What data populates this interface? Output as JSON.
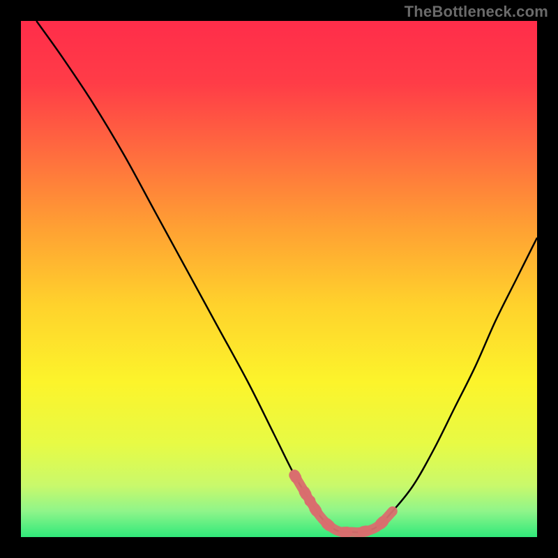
{
  "watermark": "TheBottleneck.com",
  "chart_data": {
    "type": "line",
    "title": "",
    "xlabel": "",
    "ylabel": "",
    "xlim": [
      0,
      100
    ],
    "ylim": [
      0,
      100
    ],
    "grid": false,
    "series": [
      {
        "name": "curve",
        "x": [
          3,
          8,
          14,
          20,
          26,
          32,
          38,
          44,
          49,
          53,
          56,
          58,
          60,
          62,
          64,
          66,
          69,
          72,
          76,
          80,
          84,
          88,
          92,
          96,
          100
        ],
        "values": [
          100,
          93,
          84,
          74,
          63,
          52,
          41,
          30,
          20,
          12,
          7,
          4,
          2,
          1,
          1,
          1,
          2,
          5,
          10,
          17,
          25,
          33,
          42,
          50,
          58
        ]
      }
    ],
    "highlight_segment": {
      "x": [
        53,
        56,
        58,
        60,
        62,
        64,
        66,
        69,
        72
      ],
      "values": [
        12,
        7,
        4,
        2,
        1,
        1,
        1,
        2,
        5
      ]
    },
    "gradient_stops": [
      {
        "offset": 0.0,
        "color": "#FF2D4A"
      },
      {
        "offset": 0.12,
        "color": "#FF3C47"
      },
      {
        "offset": 0.25,
        "color": "#FF6A3F"
      },
      {
        "offset": 0.4,
        "color": "#FFA033"
      },
      {
        "offset": 0.55,
        "color": "#FFD22C"
      },
      {
        "offset": 0.7,
        "color": "#FCF42B"
      },
      {
        "offset": 0.82,
        "color": "#E7FA45"
      },
      {
        "offset": 0.9,
        "color": "#C9F96B"
      },
      {
        "offset": 0.95,
        "color": "#8FF58A"
      },
      {
        "offset": 1.0,
        "color": "#30E97A"
      }
    ],
    "highlight_color": "#D96E6E",
    "curve_color": "#000000"
  }
}
